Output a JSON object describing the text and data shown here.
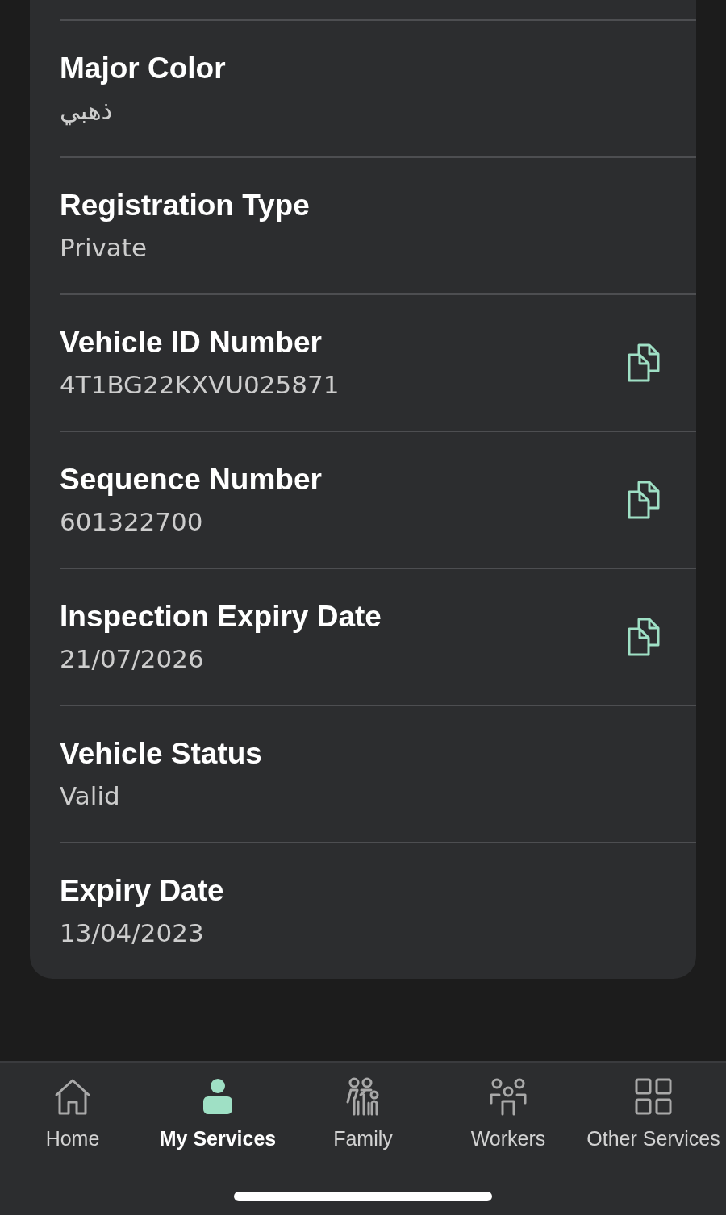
{
  "details": [
    {
      "label": "Major Color",
      "value": "ذهبي",
      "copyable": false
    },
    {
      "label": "Registration Type",
      "value": "Private",
      "copyable": false
    },
    {
      "label": "Vehicle ID Number",
      "value": "4T1BG22KXVU025871",
      "copyable": true
    },
    {
      "label": "Sequence Number",
      "value": "601322700",
      "copyable": true
    },
    {
      "label": "Inspection Expiry Date",
      "value": "21/07/2026",
      "copyable": true
    },
    {
      "label": "Vehicle Status",
      "value": "Valid",
      "copyable": false
    },
    {
      "label": "Expiry Date",
      "value": "13/04/2023",
      "copyable": false
    }
  ],
  "nav": [
    {
      "label": "Home",
      "selected": false
    },
    {
      "label": "My Services",
      "selected": true
    },
    {
      "label": "Family",
      "selected": false
    },
    {
      "label": "Workers",
      "selected": false
    },
    {
      "label": "Other Services",
      "selected": false
    }
  ]
}
